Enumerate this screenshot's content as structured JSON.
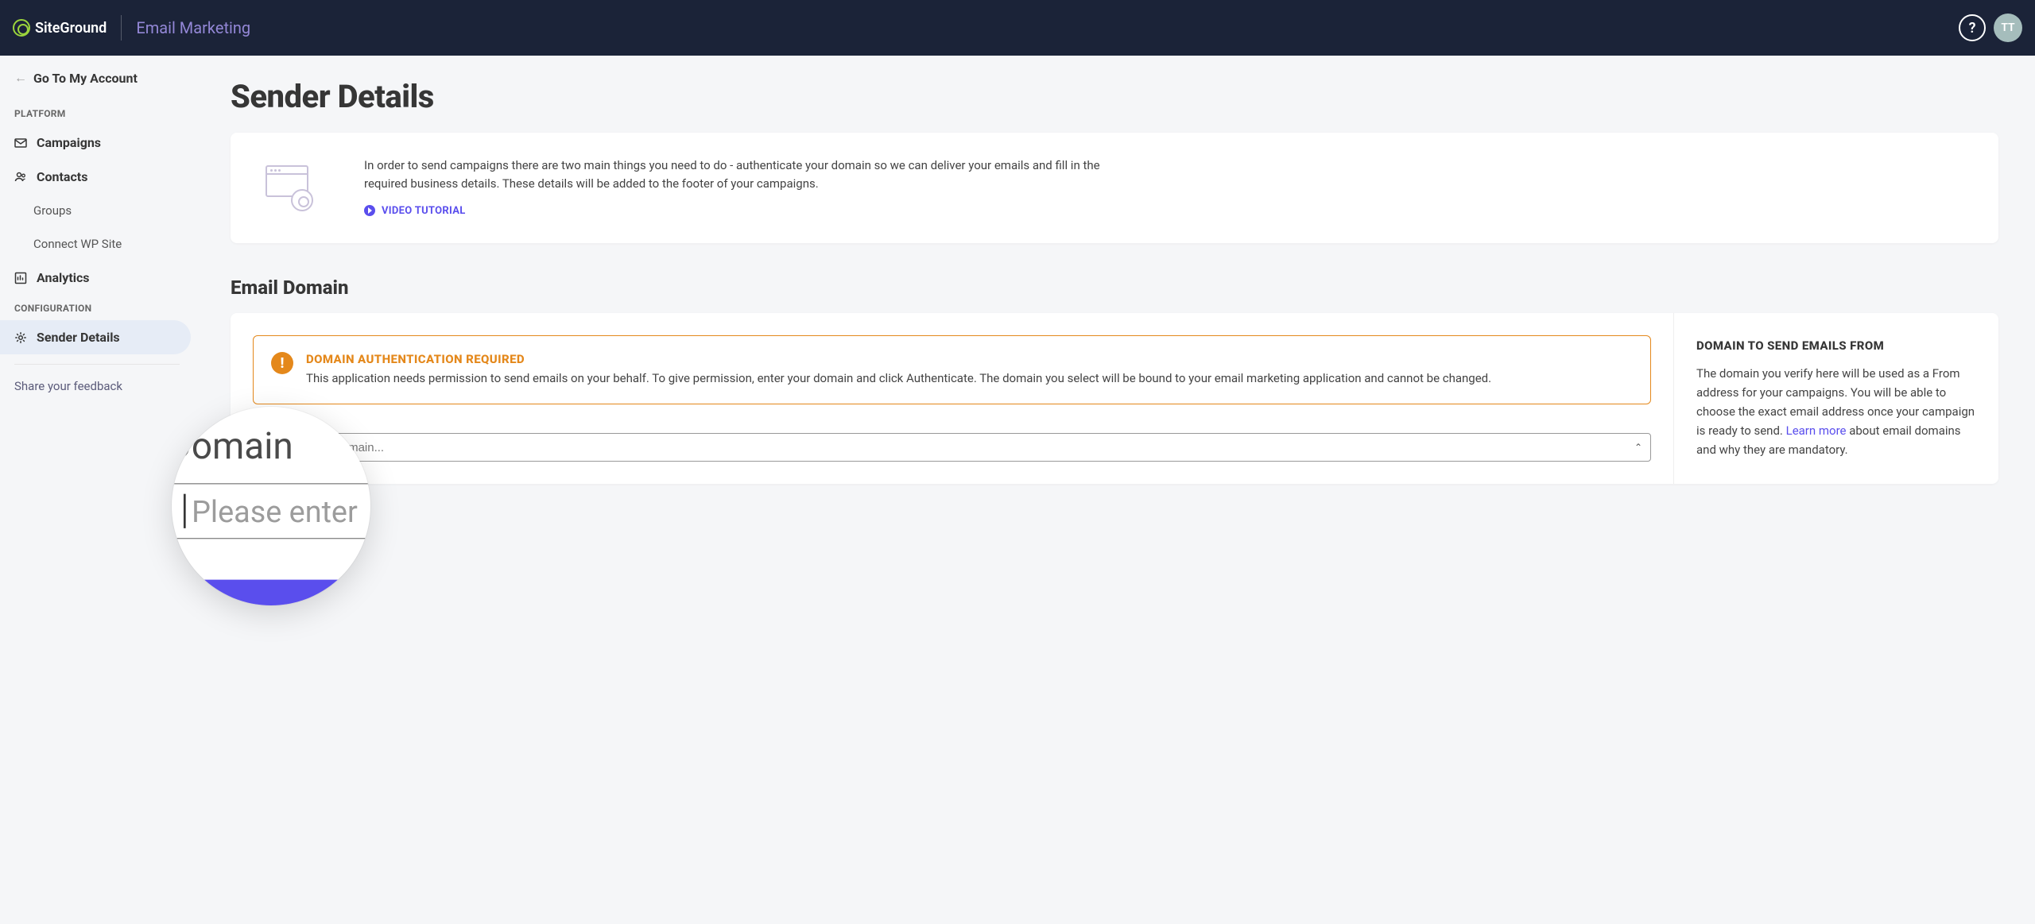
{
  "header": {
    "logo_text": "SiteGround",
    "product": "Email Marketing",
    "help_glyph": "?",
    "avatar_initials": "TT"
  },
  "sidebar": {
    "back": "Go To My Account",
    "section_platform": "PLATFORM",
    "section_config": "CONFIGURATION",
    "items": {
      "campaigns": "Campaigns",
      "contacts": "Contacts",
      "groups": "Groups",
      "connect_wp": "Connect WP Site",
      "analytics": "Analytics",
      "sender_details": "Sender Details"
    },
    "feedback": "Share your feedback"
  },
  "page": {
    "title": "Sender Details",
    "intro_text": "In order to send campaigns there are two main things you need to do - authenticate your domain so we can deliver your emails and fill in the required business details. These details will be added to the footer of your campaigns.",
    "video_link": "VIDEO TUTORIAL",
    "email_domain_heading": "Email Domain",
    "alert": {
      "title": "DOMAIN AUTHENTICATION REQUIRED",
      "text": "This application needs permission to send emails on your behalf. To give permission, enter your domain and click Authenticate. The domain you select will be bound to your email marketing application and cannot be changed."
    },
    "domain_input": {
      "placeholder": "Please enter domain..."
    },
    "right_panel": {
      "heading": "DOMAIN TO SEND EMAILS FROM",
      "text_before_link": "The domain you verify here will be used as a From address for your campaigns. You will be able to choose the exact email address once your campaign is ready to send. ",
      "link": "Learn more",
      "text_after_link": " about email domains and why they are mandatory."
    }
  },
  "magnifier": {
    "label": "Domain",
    "placeholder": "Please enter"
  }
}
